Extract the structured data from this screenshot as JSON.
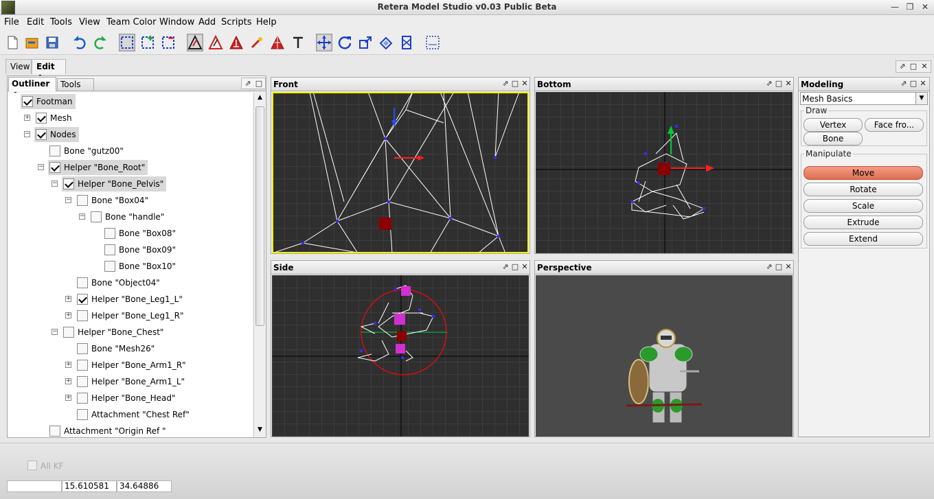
{
  "app": {
    "title": "Retera Model Studio v0.03 Public Beta"
  },
  "menu": [
    "File",
    "Edit",
    "Tools",
    "View",
    "Team Color",
    "Window",
    "Add",
    "Scripts",
    "Help"
  ],
  "toolbar_icons": [
    "new-file-icon",
    "open-folder-icon",
    "save-icon",
    "undo-icon",
    "redo-icon",
    "select-icon",
    "select-add-icon",
    "select-deselect-icon",
    "draw-triangle-icon",
    "draw-triangle-outline-icon",
    "draw-triangle-filled-icon",
    "paint-brush-icon",
    "triangle-grid-icon",
    "text-icon",
    "move-icon",
    "rotate-icon",
    "scale-icon",
    "extrude-icon",
    "extend-icon",
    "snap-icon"
  ],
  "tabs": {
    "view": "View",
    "edit": "Edit"
  },
  "outliner": {
    "tab_outliner": "Outliner",
    "tab_tools": "Tools",
    "nodes": [
      {
        "label": "Footman",
        "checked": true,
        "hl": true
      },
      {
        "label": "Mesh",
        "checked": true,
        "hl": false
      },
      {
        "label": "Nodes",
        "checked": true,
        "hl": true
      },
      {
        "label": "Bone \"gutz00\"",
        "checked": false,
        "hl": false
      },
      {
        "label": "Helper \"Bone_Root\"",
        "checked": true,
        "hl": true
      },
      {
        "label": "Helper \"Bone_Pelvis\"",
        "checked": true,
        "hl": true
      },
      {
        "label": "Bone \"Box04\"",
        "checked": false,
        "hl": false
      },
      {
        "label": "Bone \"handle\"",
        "checked": false,
        "hl": false
      },
      {
        "label": "Bone \"Box08\"",
        "checked": false,
        "hl": false
      },
      {
        "label": "Bone \"Box09\"",
        "checked": false,
        "hl": false
      },
      {
        "label": "Bone \"Box10\"",
        "checked": false,
        "hl": false
      },
      {
        "label": "Bone \"Object04\"",
        "checked": false,
        "hl": false
      },
      {
        "label": "Helper \"Bone_Leg1_L\"",
        "checked": true,
        "hl": false
      },
      {
        "label": "Helper \"Bone_Leg1_R\"",
        "checked": false,
        "hl": false
      },
      {
        "label": "Helper \"Bone_Chest\"",
        "checked": false,
        "hl": false
      },
      {
        "label": "Bone \"Mesh26\"",
        "checked": false,
        "hl": false
      },
      {
        "label": "Helper \"Bone_Arm1_R\"",
        "checked": false,
        "hl": false
      },
      {
        "label": "Helper \"Bone_Arm1_L\"",
        "checked": false,
        "hl": false
      },
      {
        "label": "Helper \"Bone_Head\"",
        "checked": false,
        "hl": false
      },
      {
        "label": "Attachment \"Chest Ref\"",
        "checked": false,
        "hl": false
      },
      {
        "label": "Attachment \"Origin Ref \"",
        "checked": false,
        "hl": false
      }
    ]
  },
  "viewports": {
    "front": "Front",
    "bottom": "Bottom",
    "side": "Side",
    "perspective": "Perspective"
  },
  "modeling": {
    "title": "Modeling",
    "mode_select": "Mesh Basics",
    "draw_label": "Draw",
    "draw_buttons": [
      "Vertex",
      "Face fro...",
      "Bone"
    ],
    "manipulate_label": "Manipulate",
    "manipulate_buttons": [
      "Move",
      "Rotate",
      "Scale",
      "Extrude",
      "Extend"
    ]
  },
  "bottom": {
    "all_kf": "All KF",
    "coord_x": "15.610581",
    "coord_y": "34.64886"
  }
}
